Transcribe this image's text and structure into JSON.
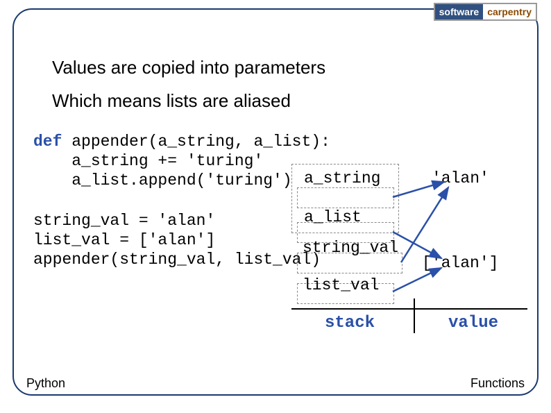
{
  "logo": {
    "left": "software",
    "right": "carpentry"
  },
  "headings": {
    "line1": "Values are copied into parameters",
    "line2": "Which means lists are aliased"
  },
  "code": {
    "kwd_def": "def",
    "def_sig": " appender(a_string, a_list):",
    "body1": "    a_string += 'turing'",
    "body2": "    a_list.append('turing')",
    "stmt1": "string_val = 'alan'",
    "stmt2": "list_val = ['alan']",
    "stmt3": "appender(string_val, list_val)"
  },
  "diagram": {
    "vars": {
      "a_string": "a_string",
      "a_list": "a_list",
      "string_val": "string_val",
      "list_val": "list_val"
    },
    "values": {
      "alan": "'alan'",
      "list_alan": "['alan']"
    },
    "table": {
      "stack": "stack",
      "value": "value"
    }
  },
  "footer": {
    "left": "Python",
    "right": "Functions"
  }
}
